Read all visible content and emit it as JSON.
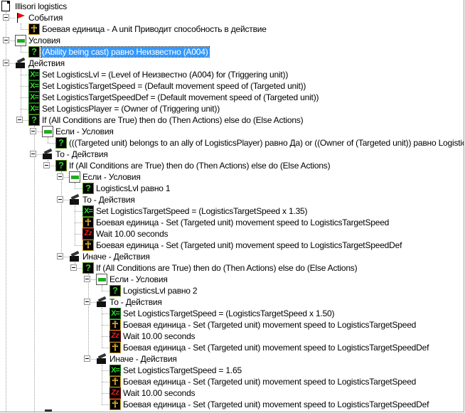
{
  "trigger_tree": {
    "rows": [
      {
        "level": 0,
        "icon": "document-icon",
        "text": "Illisori logistics"
      },
      {
        "level": 1,
        "icon": "event-flag-icon",
        "text": "События",
        "expandable": true
      },
      {
        "level": 2,
        "icon": "unit-icon",
        "text": "Боевая единица - A unit Приводит способность в действие"
      },
      {
        "level": 1,
        "icon": "conditions-icon",
        "text": "Условия",
        "expandable": true
      },
      {
        "level": 2,
        "icon": "condition-question-icon",
        "text": "(Ability being cast) равно Неизвестно (A004)",
        "selected": true
      },
      {
        "level": 1,
        "icon": "actions-icon",
        "text": "Действия",
        "expandable": true
      },
      {
        "level": 2,
        "icon": "set-variable-icon",
        "text": "Set LogisticsLvl = (Level of Неизвестно (A004) for (Triggering unit))"
      },
      {
        "level": 2,
        "icon": "set-variable-icon",
        "text": "Set LogisticsTargetSpeed = (Default movement speed of (Targeted unit))"
      },
      {
        "level": 2,
        "icon": "set-variable-icon",
        "text": "Set LogisticsTargetSpeedDef = (Default movement speed of (Targeted unit))"
      },
      {
        "level": 2,
        "icon": "set-variable-icon",
        "text": "Set LogisticsPlayer = (Owner of (Triggering unit))"
      },
      {
        "level": 2,
        "icon": "condition-question-icon",
        "text": "If (All Conditions are True) then do (Then Actions) else do (Else Actions)",
        "expandable": true
      },
      {
        "level": 3,
        "icon": "conditions-icon",
        "text": "Если - Условия",
        "expandable": true
      },
      {
        "level": 4,
        "icon": "condition-question-icon",
        "text": "(((Targeted unit) belongs to an ally of LogisticsPlayer) равно Да) or ((Owner of (Targeted unit)) равно LogisticsPlayer)"
      },
      {
        "level": 3,
        "icon": "actions-icon",
        "text": "То - Действия",
        "expandable": true
      },
      {
        "level": 4,
        "icon": "condition-question-icon",
        "text": "If (All Conditions are True) then do (Then Actions) else do (Else Actions)",
        "expandable": true
      },
      {
        "level": 5,
        "icon": "conditions-icon",
        "text": "Если - Условия",
        "expandable": true
      },
      {
        "level": 6,
        "icon": "condition-question-icon",
        "text": "LogisticsLvl равно 1"
      },
      {
        "level": 5,
        "icon": "actions-icon",
        "text": "То - Действия",
        "expandable": true
      },
      {
        "level": 6,
        "icon": "set-variable-icon",
        "text": "Set LogisticsTargetSpeed = (LogisticsTargetSpeed x 1.35)"
      },
      {
        "level": 6,
        "icon": "unit-icon",
        "text": "Боевая единица - Set (Targeted unit) movement speed to LogisticsTargetSpeed"
      },
      {
        "level": 6,
        "icon": "wait-icon",
        "text": "Wait 10.00 seconds"
      },
      {
        "level": 6,
        "icon": "unit-icon",
        "text": "Боевая единица - Set (Targeted unit) movement speed to LogisticsTargetSpeedDef"
      },
      {
        "level": 5,
        "icon": "actions-icon",
        "text": "Иначе - Действия",
        "expandable": true
      },
      {
        "level": 6,
        "icon": "condition-question-icon",
        "text": "If (All Conditions are True) then do (Then Actions) else do (Else Actions)",
        "expandable": true
      },
      {
        "level": 7,
        "icon": "conditions-icon",
        "text": "Если - Условия",
        "expandable": true
      },
      {
        "level": 8,
        "icon": "condition-question-icon",
        "text": "LogisticsLvl равно 2"
      },
      {
        "level": 7,
        "icon": "actions-icon",
        "text": "То - Действия",
        "expandable": true
      },
      {
        "level": 8,
        "icon": "set-variable-icon",
        "text": "Set LogisticsTargetSpeed = (LogisticsTargetSpeed x 1.50)"
      },
      {
        "level": 8,
        "icon": "unit-icon",
        "text": "Боевая единица - Set (Targeted unit) movement speed to LogisticsTargetSpeed"
      },
      {
        "level": 8,
        "icon": "wait-icon",
        "text": "Wait 10.00 seconds"
      },
      {
        "level": 8,
        "icon": "unit-icon",
        "text": "Боевая единица - Set (Targeted unit) movement speed to LogisticsTargetSpeedDef"
      },
      {
        "level": 7,
        "icon": "actions-icon",
        "text": "Иначе - Действия",
        "expandable": true
      },
      {
        "level": 8,
        "icon": "set-variable-icon",
        "text": "Set LogisticsTargetSpeed = 1.65"
      },
      {
        "level": 8,
        "icon": "unit-icon",
        "text": "Боевая единица - Set (Targeted unit) movement speed to LogisticsTargetSpeed"
      },
      {
        "level": 8,
        "icon": "wait-icon",
        "text": "Wait 10.00 seconds"
      },
      {
        "level": 8,
        "icon": "unit-icon",
        "text": "Боевая единица - Set (Targeted unit) movement speed to LogisticsTargetSpeedDef"
      }
    ],
    "selection_color": "#3399ff"
  }
}
